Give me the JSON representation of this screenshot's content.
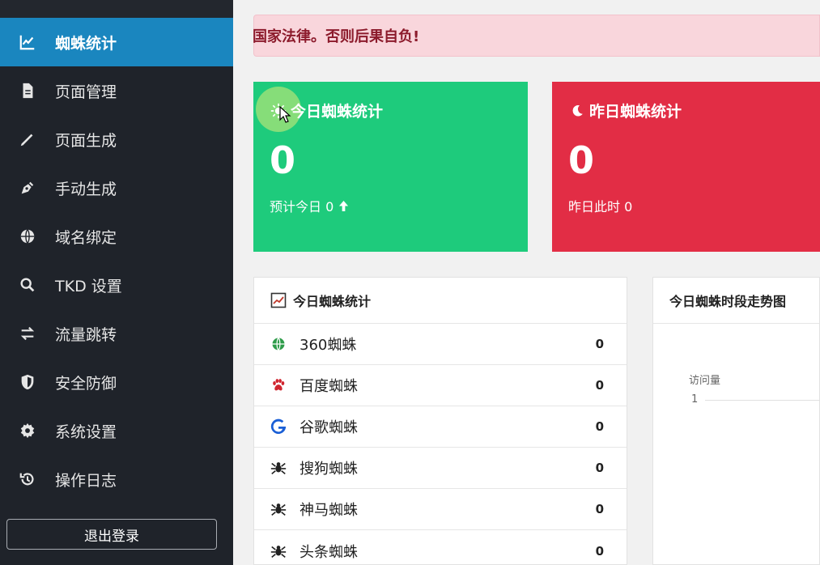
{
  "sidebar": {
    "items": [
      {
        "label": "蜘蛛统计",
        "icon": "chart-line-icon",
        "active": true
      },
      {
        "label": "页面管理",
        "icon": "file-icon"
      },
      {
        "label": "页面生成",
        "icon": "pencil-icon"
      },
      {
        "label": "手动生成",
        "icon": "pen-nib-icon"
      },
      {
        "label": "域名绑定",
        "icon": "globe-icon"
      },
      {
        "label": "TKD 设置",
        "icon": "search-icon"
      },
      {
        "label": "流量跳转",
        "icon": "exchange-icon"
      },
      {
        "label": "安全防御",
        "icon": "shield-icon"
      },
      {
        "label": "系统设置",
        "icon": "gear-icon"
      },
      {
        "label": "操作日志",
        "icon": "history-icon"
      }
    ],
    "logout_label": "退出登录"
  },
  "alert": {
    "text": "国家法律。否则后果自负!"
  },
  "today_card": {
    "title": "今日蜘蛛统计",
    "value": "0",
    "sub": "预计今日 0",
    "color": "#1ecb7c"
  },
  "yesterday_card": {
    "title": "昨日蜘蛛统计",
    "value": "0",
    "sub": "昨日此时 0",
    "color": "#e22d45"
  },
  "spider_panel": {
    "title": "今日蜘蛛统计",
    "rows": [
      {
        "label": "360蜘蛛",
        "count": "0",
        "icon": "globe-icon"
      },
      {
        "label": "百度蜘蛛",
        "count": "0",
        "icon": "paw-icon"
      },
      {
        "label": "谷歌蜘蛛",
        "count": "0",
        "icon": "google-icon"
      },
      {
        "label": "搜狗蜘蛛",
        "count": "0",
        "icon": "spider-icon"
      },
      {
        "label": "神马蜘蛛",
        "count": "0",
        "icon": "spider-icon"
      },
      {
        "label": "头条蜘蛛",
        "count": "0",
        "icon": "spider-icon"
      }
    ]
  },
  "trend_panel": {
    "title": "今日蜘蛛时段走势图",
    "ylabel": "访问量",
    "tick": "1"
  }
}
